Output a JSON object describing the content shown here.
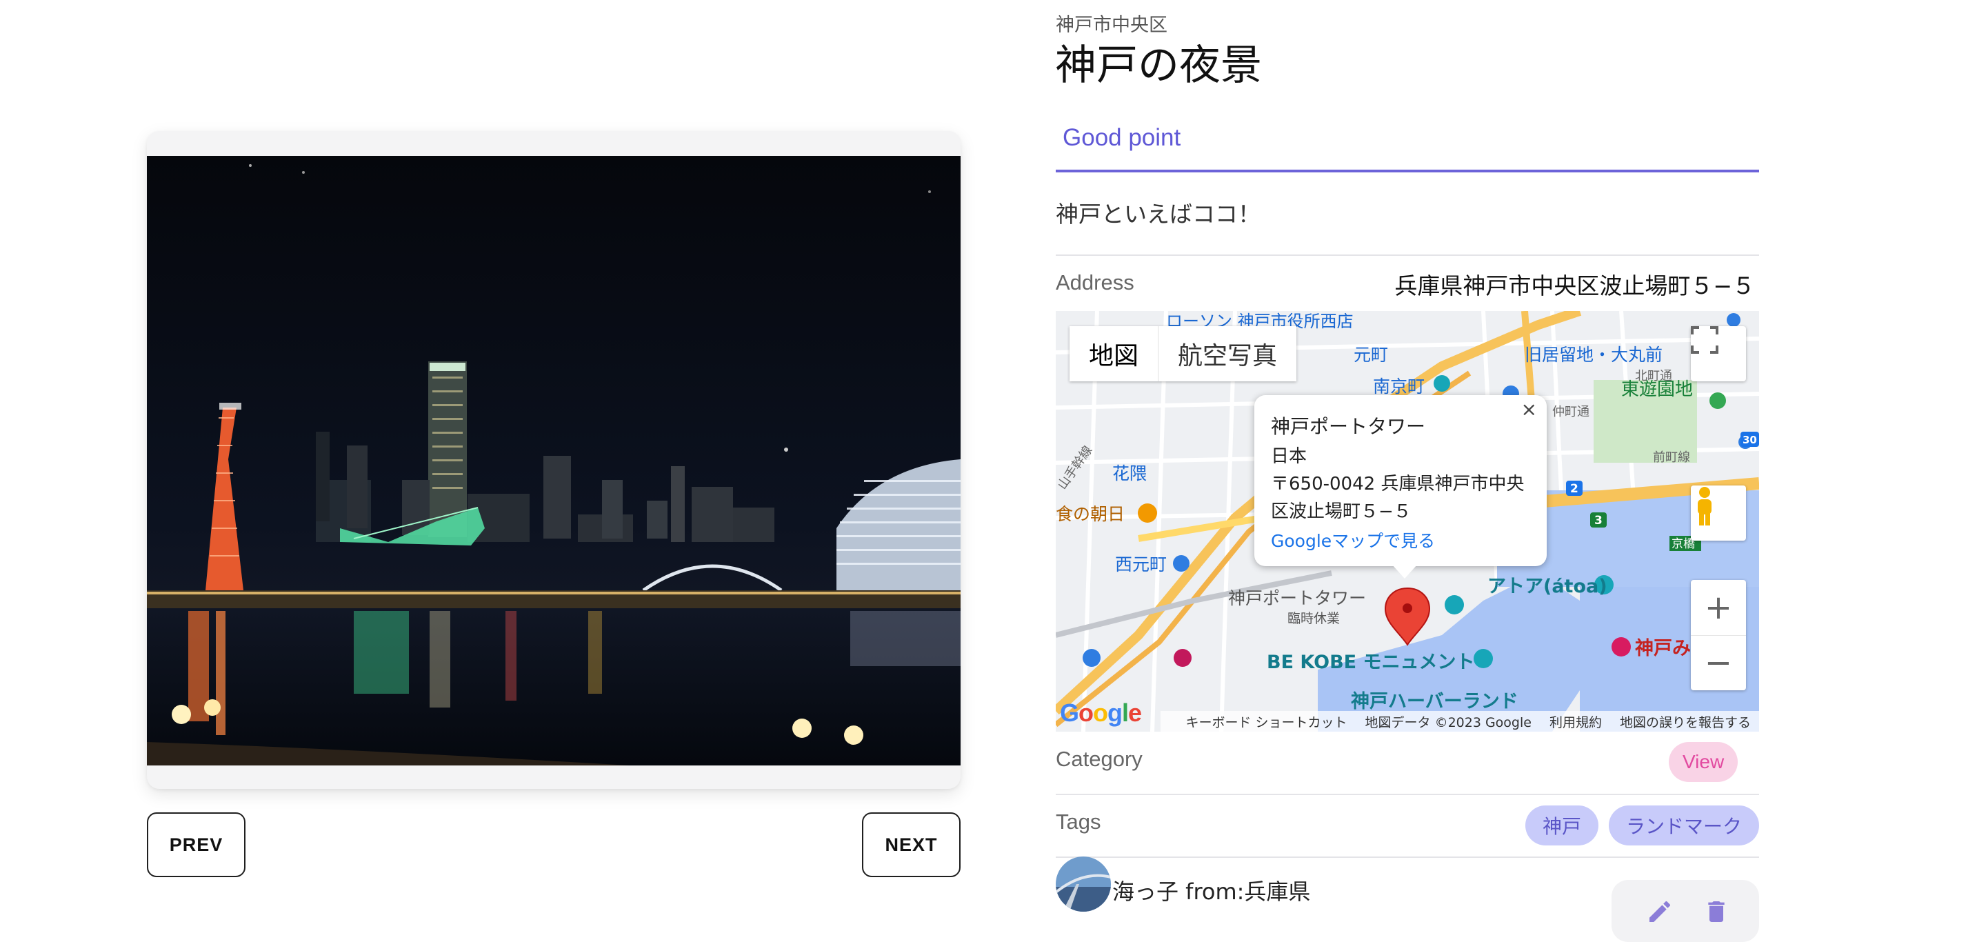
{
  "spot": {
    "district": "神戸市中央区",
    "title": "神戸の夜景"
  },
  "tabs": {
    "active_label": "Good point"
  },
  "description": "神戸といえばココ！",
  "address": {
    "label": "Address",
    "value": "兵庫県神戸市中央区波止場町５−５"
  },
  "map": {
    "type_map_label": "地図",
    "type_satellite_label": "航空写真",
    "zoom_in_label": "+",
    "zoom_out_label": "−",
    "info": {
      "name": "神戸ポートタワー",
      "country": "日本",
      "address_line1": "〒650-0042 兵庫県神戸市中央",
      "address_line2": "区波止場町５−５",
      "link_label": "Googleマップで見る",
      "close_label": "×"
    },
    "labels": {
      "motomachi": "元町",
      "kyu_kyoryuchi": "旧居留地・大丸前",
      "nankinmachi": "南京町",
      "higashi_yuenchi": "東遊園地",
      "hanakuma": "花隈",
      "asahi": "食の朝日",
      "nishi_motomachi": "西元町",
      "port_tower": "神戸ポートタワー",
      "rinji_kyugyo": "臨時休業",
      "atoa": "アトア(átoa)",
      "be_kobe": "BE KOBE モニュメント",
      "harborland": "神戸ハーバーランド",
      "kobe_mi": "神戸み",
      "yamate": "山手幹線",
      "kitamachi": "北町通",
      "nakamachi": "仲町通",
      "maemachi": "前町線",
      "kyobashi": "京橋",
      "city_office": "ローソン 神戸市役所西店",
      "route_2": "2",
      "route_3": "3",
      "route_30": "30"
    },
    "footer": {
      "logo": "Google",
      "shortcuts": "キーボード ショートカット",
      "map_data": "地図データ ©2023 Google",
      "terms": "利用規約",
      "report": "地図の誤りを報告する"
    }
  },
  "category": {
    "label": "Category",
    "value": "View"
  },
  "tags": {
    "label": "Tags",
    "items": [
      "神戸",
      "ランドマーク"
    ]
  },
  "user": {
    "name": "海っ子 from:兵庫県"
  },
  "navigation": {
    "prev_label": "PREV",
    "next_label": "NEXT"
  },
  "colors": {
    "accent": "#6c63d9",
    "category_bg": "#f9d3e6",
    "category_text": "#e24aa0",
    "tag_bg": "#c8cbfa",
    "tag_text": "#5a55c7",
    "map_pin": "#ea4335",
    "action_icon": "#8b7dd8"
  },
  "icons": {
    "edit": "pencil-icon",
    "delete": "trash-icon",
    "fullscreen": "fullscreen-icon",
    "pegman": "street-view-pegman-icon",
    "map_pin": "map-pin-icon"
  }
}
